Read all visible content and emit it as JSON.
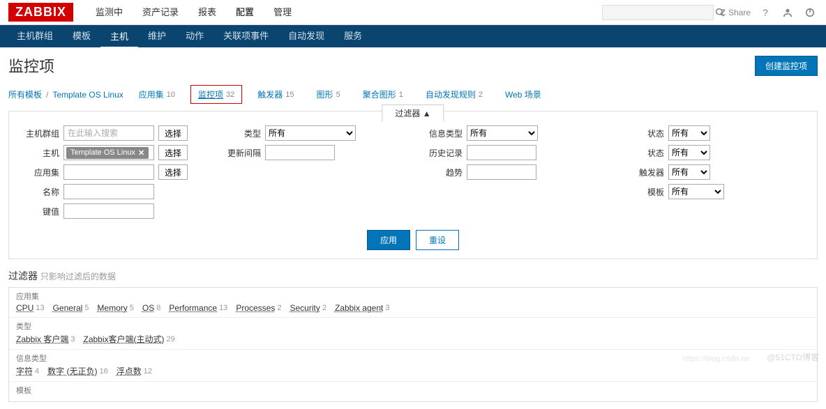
{
  "logo": "ZABBIX",
  "top_nav": [
    "监测中",
    "资产记录",
    "报表",
    "配置",
    "管理"
  ],
  "top_nav_active": 3,
  "share_label": "Share",
  "sub_nav": [
    "主机群组",
    "模板",
    "主机",
    "维护",
    "动作",
    "关联项事件",
    "自动发现",
    "服务"
  ],
  "sub_nav_active": 2,
  "page_title": "监控项",
  "create_button": "创建监控项",
  "breadcrumb": {
    "all": "所有模板",
    "current": "Template OS Linux"
  },
  "tabs": [
    {
      "label": "应用集",
      "count": 10
    },
    {
      "label": "监控项",
      "count": 32,
      "highlighted": true
    },
    {
      "label": "触发器",
      "count": 15
    },
    {
      "label": "图形",
      "count": 5
    },
    {
      "label": "聚合图形",
      "count": 1
    },
    {
      "label": "自动发现规则",
      "count": 2
    },
    {
      "label": "Web 场景",
      "count": ""
    }
  ],
  "filter": {
    "header": "过滤器 ▲",
    "select_btn": "选择",
    "search_placeholder": "在此输入搜索",
    "labels": {
      "host_group": "主机群组",
      "host": "主机",
      "application": "应用集",
      "name": "名称",
      "key": "键值",
      "type": "类型",
      "update_interval": "更新间隔",
      "info_type": "信息类型",
      "history": "历史记录",
      "trend": "趋势",
      "status": "状态",
      "state": "状态",
      "triggers": "触发器",
      "template": "模板"
    },
    "all_option": "所有",
    "host_tag": "Template OS Linux",
    "apply": "应用",
    "reset": "重设"
  },
  "subfilter": {
    "title": "过滤器",
    "hint": "只影响过滤后的数据",
    "sections": [
      {
        "label": "应用集",
        "items": [
          {
            "name": "CPU",
            "count": 13
          },
          {
            "name": "General",
            "count": 5
          },
          {
            "name": "Memory",
            "count": 5
          },
          {
            "name": "OS",
            "count": 8
          },
          {
            "name": "Performance",
            "count": 13
          },
          {
            "name": "Processes",
            "count": 2
          },
          {
            "name": "Security",
            "count": 2
          },
          {
            "name": "Zabbix agent",
            "count": 3
          }
        ]
      },
      {
        "label": "类型",
        "items": [
          {
            "name": "Zabbix 客户端",
            "count": 3
          },
          {
            "name": "Zabbix客户端(主动式)",
            "count": 29
          }
        ]
      },
      {
        "label": "信息类型",
        "items": [
          {
            "name": "字符",
            "count": 4
          },
          {
            "name": "数字 (无正负)",
            "count": 16
          },
          {
            "name": "浮点数",
            "count": 12
          }
        ]
      },
      {
        "label": "模板",
        "items": []
      }
    ]
  },
  "watermark": "@51CTO博客",
  "watermark2": "https://blog.csdn.ne"
}
